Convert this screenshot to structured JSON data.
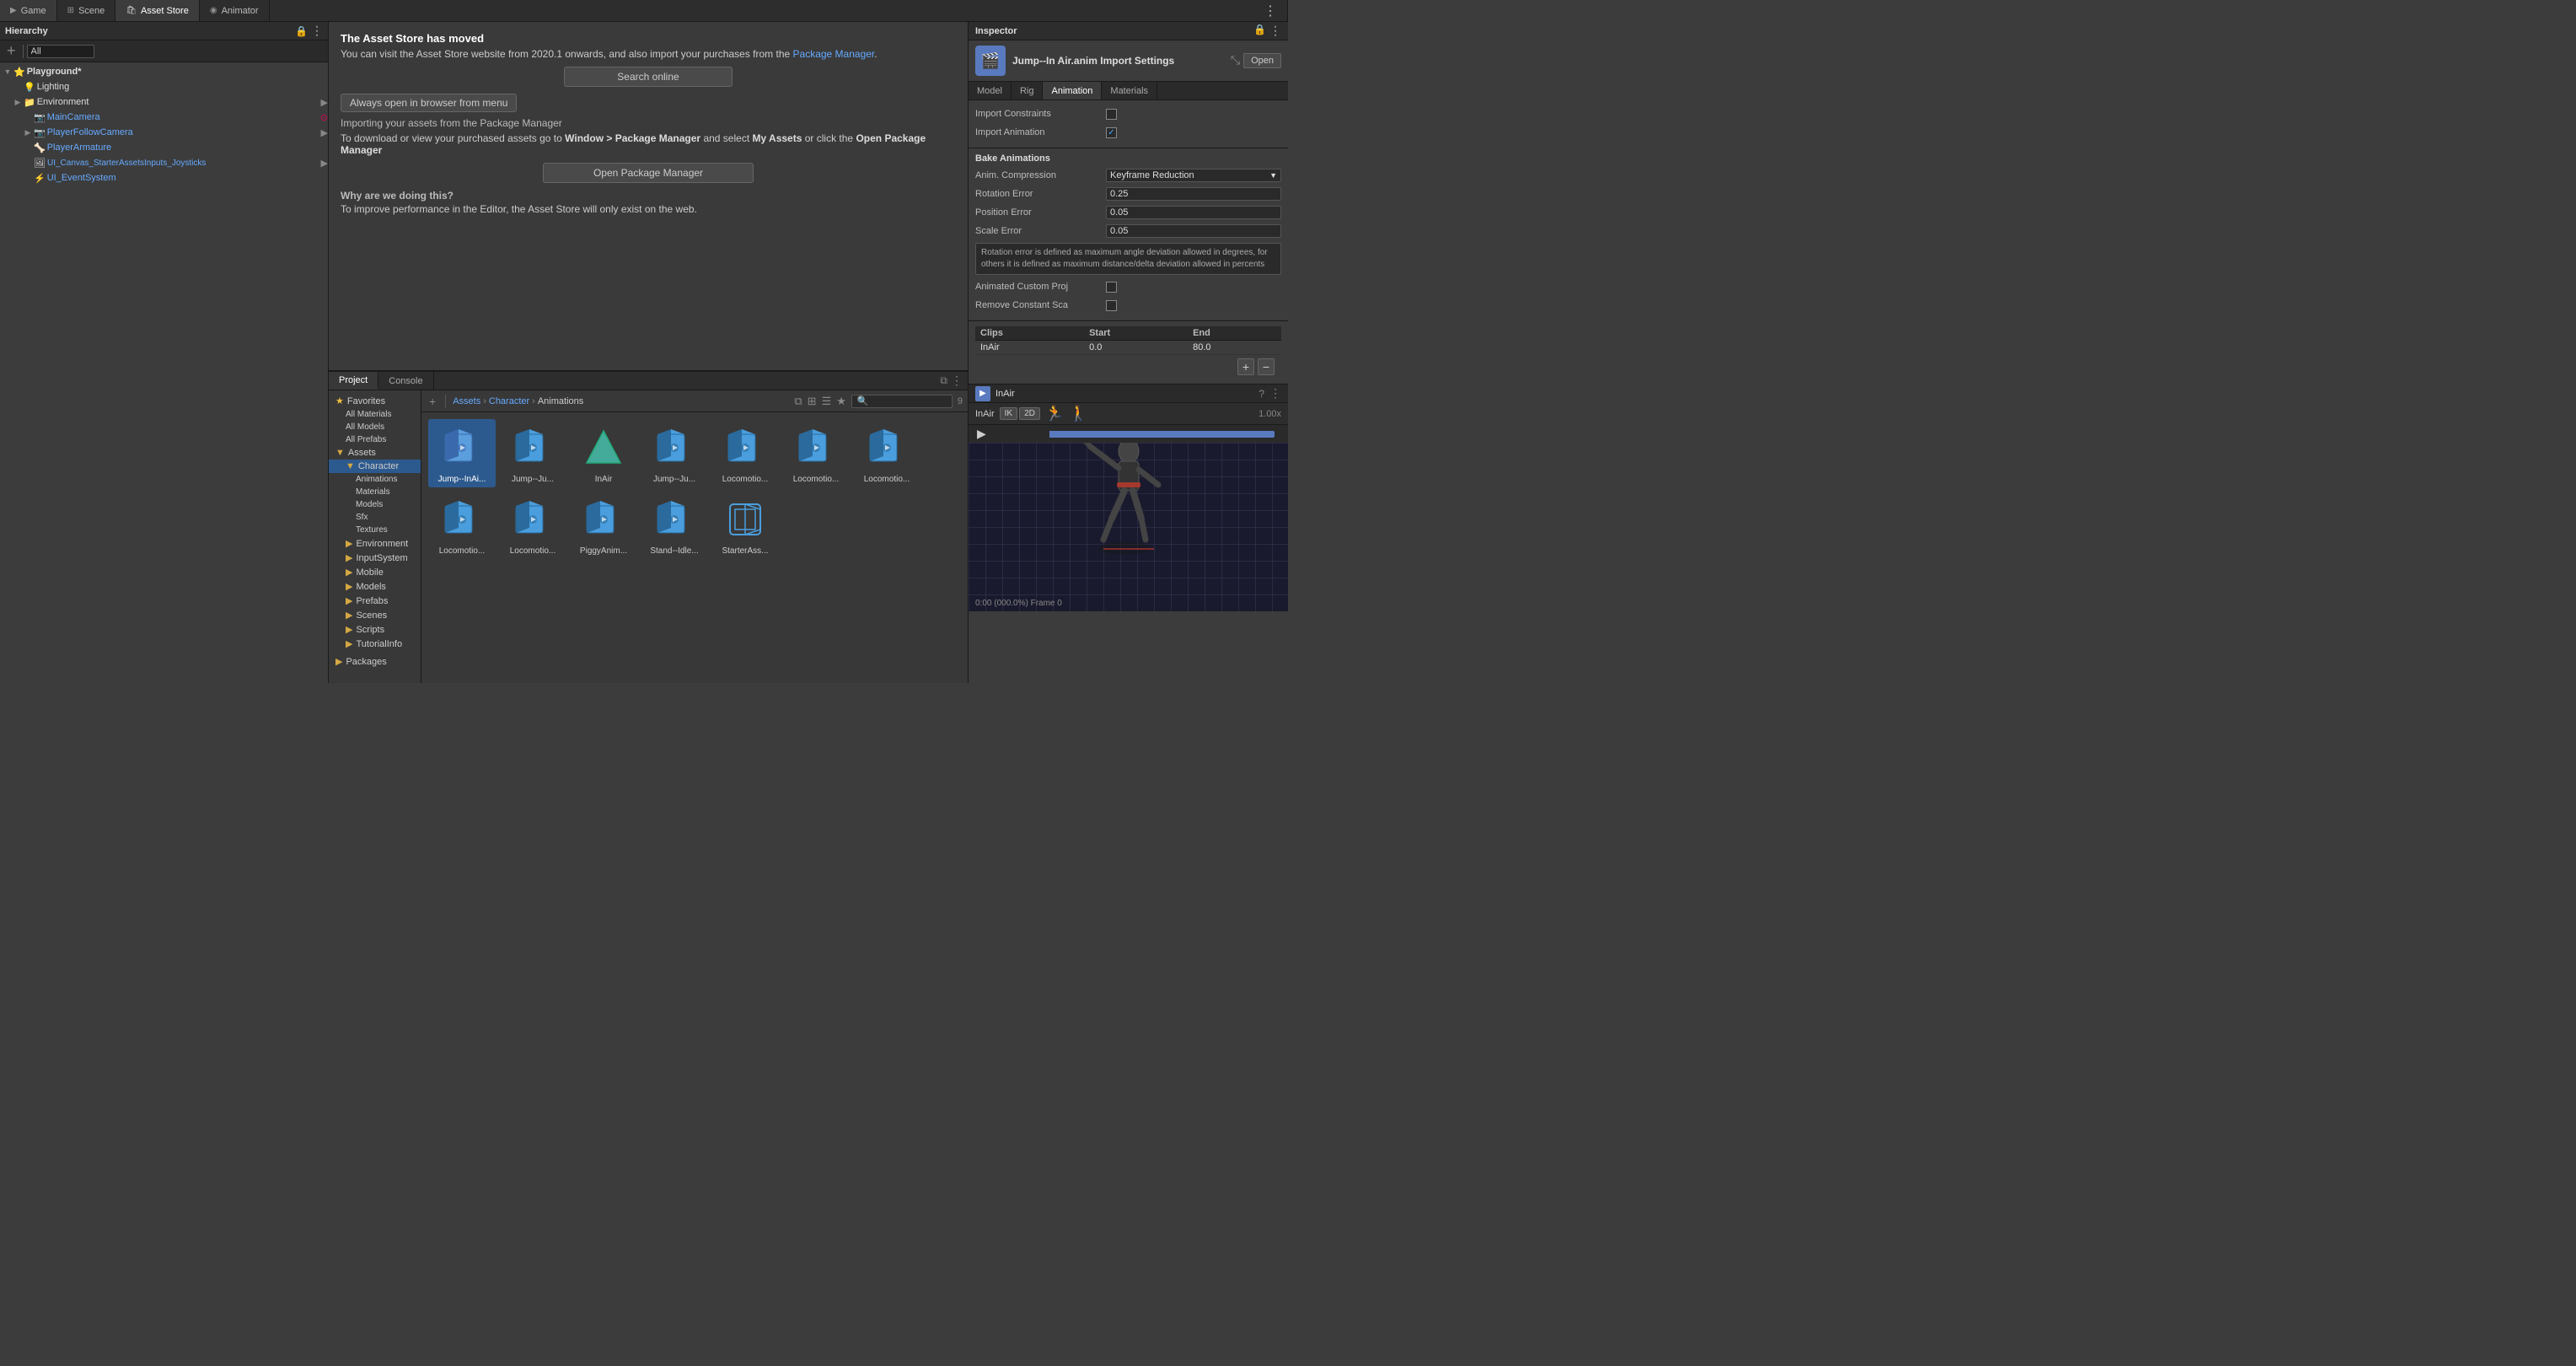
{
  "topTabs": [
    {
      "id": "game",
      "label": "Game",
      "icon": "▶",
      "active": false
    },
    {
      "id": "scene",
      "label": "Scene",
      "icon": "⊞",
      "active": false
    },
    {
      "id": "assetstore",
      "label": "Asset Store",
      "icon": "🛍",
      "active": true
    },
    {
      "id": "animator",
      "label": "Animator",
      "icon": "◉",
      "active": false
    }
  ],
  "hierarchy": {
    "title": "Hierarchy",
    "searchPlaceholder": "All",
    "items": [
      {
        "label": "Playground*",
        "depth": 0,
        "hasArrow": true,
        "expanded": true,
        "bold": true
      },
      {
        "label": "Lighting",
        "depth": 1,
        "hasArrow": false,
        "icon": "💡"
      },
      {
        "label": "Environment",
        "depth": 1,
        "hasArrow": true,
        "expanded": false
      },
      {
        "label": "MainCamera",
        "depth": 2,
        "hasArrow": false,
        "blue": true,
        "icon": "📷"
      },
      {
        "label": "PlayerFollowCamera",
        "depth": 2,
        "hasArrow": true,
        "expanded": false,
        "blue": true
      },
      {
        "label": "PlayerArmature",
        "depth": 2,
        "hasArrow": false,
        "blue": true
      },
      {
        "label": "UI_Canvas_StarterAssetsInputs_Joysticks",
        "depth": 2,
        "hasArrow": false,
        "blue": true
      },
      {
        "label": "UI_EventSystem",
        "depth": 2,
        "hasArrow": false,
        "blue": true
      }
    ]
  },
  "assetStore": {
    "title": "The Asset Store has moved",
    "line1": "You can visit the Asset Store website from 2020.1 onwards, and also import your purchases from the ",
    "pmLink": "Package Manager",
    "line1end": ".",
    "searchBtn": "Search online",
    "alwaysOpenBtn": "Always open in browser from menu",
    "importHeading": "Importing your assets from the Package Manager",
    "importDetail1": "To download or view your purchased assets go to ",
    "importBold1": "Window > Package Manager",
    "importDetail2": " and select ",
    "importBold2": "My Assets",
    "importDetail3": " or click the ",
    "importBold3": "Open Package Manager",
    "openPkgBtn": "Open Package Manager",
    "whyHeading": "Why are we doing this?",
    "whyDetail": "To improve performance in the Editor, the Asset Store will only exist on the web."
  },
  "inspector": {
    "title": "Inspector",
    "fileTitle": "Jump--In Air.anim Import Settings",
    "tabs": [
      "Model",
      "Rig",
      "Animation",
      "Materials"
    ],
    "activeTab": "Animation",
    "sections": {
      "importConstraints": {
        "label": "Import Constraints",
        "checked": false
      },
      "importAnimation": {
        "label": "Import Animation",
        "checked": true
      },
      "bakeAnimations": {
        "title": "Bake Animations",
        "animCompression": {
          "label": "Anim. Compression",
          "value": "Keyframe Reduction"
        },
        "rotationError": {
          "label": "Rotation Error",
          "value": "0.25"
        },
        "positionError": {
          "label": "Position Error",
          "value": "0.05"
        },
        "scaleError": {
          "label": "Scale Error",
          "value": "0.05"
        },
        "infoBox": "Rotation error is defined as maximum angle deviation allowed in degrees, for others it is defined as maximum distance/delta deviation allowed in percents",
        "animatedCustomProp": {
          "label": "Animated Custom Proj",
          "checked": false
        },
        "removeConstantSca": {
          "label": "Remove Constant Sca",
          "checked": false
        }
      },
      "clips": {
        "header": [
          "Clips",
          "Start",
          "End"
        ],
        "rows": [
          {
            "name": "InAir",
            "start": "0.0",
            "end": "80.0"
          }
        ]
      }
    }
  },
  "animPreview": {
    "name": "InAir",
    "ikLabel": "IK",
    "twoDLabel": "2D",
    "speed": "1.00x",
    "timestamp": "0:00 (000.0%) Frame 0"
  },
  "project": {
    "tabs": [
      "Project",
      "Console"
    ],
    "activeTab": "Project",
    "breadcrumb": [
      "Assets",
      "Character",
      "Animations"
    ],
    "searchPlaceholder": "🔍",
    "assetCount": "9",
    "sidebar": {
      "favorites": {
        "label": "Favorites",
        "items": [
          "All Materials",
          "All Models",
          "All Prefabs"
        ]
      },
      "assets": {
        "label": "Assets",
        "folders": [
          {
            "label": "Character",
            "expanded": true,
            "selected": true,
            "subfolders": [
              "Animations",
              "Materials",
              "Models",
              "Sfx",
              "Textures"
            ]
          },
          {
            "label": "Environment"
          },
          {
            "label": "InputSystem"
          },
          {
            "label": "Mobile"
          },
          {
            "label": "Models"
          },
          {
            "label": "Prefabs"
          },
          {
            "label": "Scenes"
          },
          {
            "label": "Scripts"
          },
          {
            "label": "TutorialInfo"
          }
        ]
      },
      "packages": {
        "label": "Packages"
      }
    },
    "assets": [
      {
        "name": "Jump--InAi...",
        "type": "anim",
        "selected": true
      },
      {
        "name": "Jump--Ju...",
        "type": "anim"
      },
      {
        "name": "InAir",
        "type": "triangle"
      },
      {
        "name": "Jump--Ju...",
        "type": "anim"
      },
      {
        "name": "Locomotio...",
        "type": "anim"
      },
      {
        "name": "Locomotio...",
        "type": "anim"
      },
      {
        "name": "Locomotio...",
        "type": "anim"
      },
      {
        "name": "Locomotio...",
        "type": "anim"
      },
      {
        "name": "Locomotio...",
        "type": "anim"
      },
      {
        "name": "PiggyAnim...",
        "type": "anim"
      },
      {
        "name": "Stand--Idle...",
        "type": "anim"
      },
      {
        "name": "StarterAss...",
        "type": "anim-outline"
      }
    ]
  },
  "colors": {
    "accent": "#2d5a8e",
    "panelBg": "#3c3c3c",
    "headerBg": "#2d2d2d",
    "borderColor": "#1a1a1a",
    "cubeColor": "#4a9edd",
    "cubeAccent": "#2a6a9d"
  }
}
